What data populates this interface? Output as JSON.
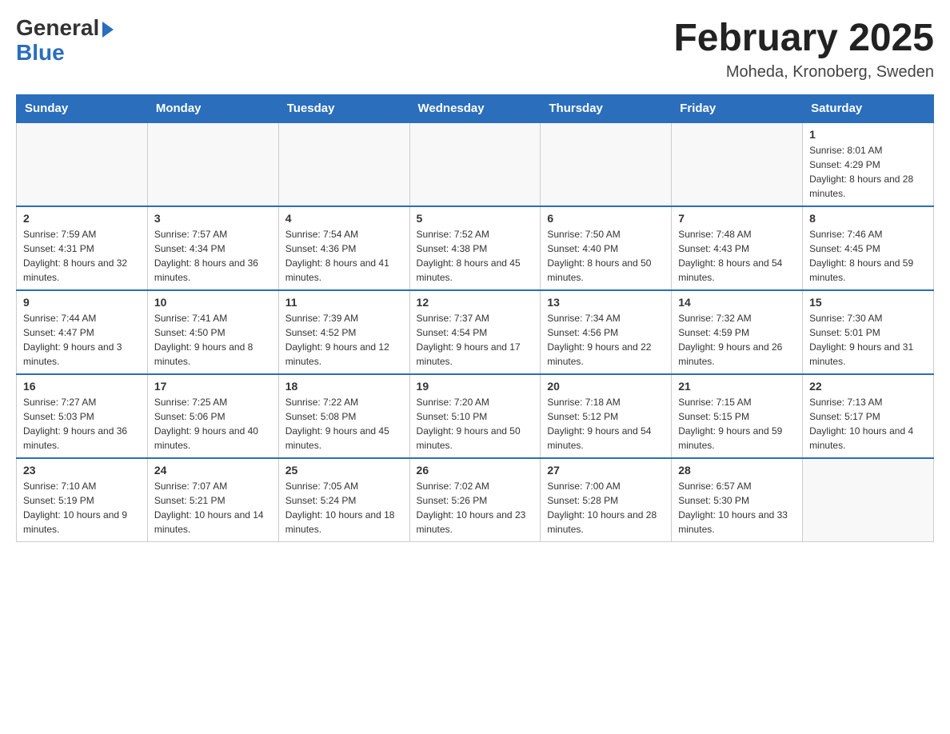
{
  "logo": {
    "general": "General",
    "blue": "Blue",
    "arrow": "▶"
  },
  "title": "February 2025",
  "location": "Moheda, Kronoberg, Sweden",
  "days_of_week": [
    "Sunday",
    "Monday",
    "Tuesday",
    "Wednesday",
    "Thursday",
    "Friday",
    "Saturday"
  ],
  "weeks": [
    {
      "days": [
        {
          "num": "",
          "info": ""
        },
        {
          "num": "",
          "info": ""
        },
        {
          "num": "",
          "info": ""
        },
        {
          "num": "",
          "info": ""
        },
        {
          "num": "",
          "info": ""
        },
        {
          "num": "",
          "info": ""
        },
        {
          "num": "1",
          "info": "Sunrise: 8:01 AM\nSunset: 4:29 PM\nDaylight: 8 hours and 28 minutes."
        }
      ]
    },
    {
      "days": [
        {
          "num": "2",
          "info": "Sunrise: 7:59 AM\nSunset: 4:31 PM\nDaylight: 8 hours and 32 minutes."
        },
        {
          "num": "3",
          "info": "Sunrise: 7:57 AM\nSunset: 4:34 PM\nDaylight: 8 hours and 36 minutes."
        },
        {
          "num": "4",
          "info": "Sunrise: 7:54 AM\nSunset: 4:36 PM\nDaylight: 8 hours and 41 minutes."
        },
        {
          "num": "5",
          "info": "Sunrise: 7:52 AM\nSunset: 4:38 PM\nDaylight: 8 hours and 45 minutes."
        },
        {
          "num": "6",
          "info": "Sunrise: 7:50 AM\nSunset: 4:40 PM\nDaylight: 8 hours and 50 minutes."
        },
        {
          "num": "7",
          "info": "Sunrise: 7:48 AM\nSunset: 4:43 PM\nDaylight: 8 hours and 54 minutes."
        },
        {
          "num": "8",
          "info": "Sunrise: 7:46 AM\nSunset: 4:45 PM\nDaylight: 8 hours and 59 minutes."
        }
      ]
    },
    {
      "days": [
        {
          "num": "9",
          "info": "Sunrise: 7:44 AM\nSunset: 4:47 PM\nDaylight: 9 hours and 3 minutes."
        },
        {
          "num": "10",
          "info": "Sunrise: 7:41 AM\nSunset: 4:50 PM\nDaylight: 9 hours and 8 minutes."
        },
        {
          "num": "11",
          "info": "Sunrise: 7:39 AM\nSunset: 4:52 PM\nDaylight: 9 hours and 12 minutes."
        },
        {
          "num": "12",
          "info": "Sunrise: 7:37 AM\nSunset: 4:54 PM\nDaylight: 9 hours and 17 minutes."
        },
        {
          "num": "13",
          "info": "Sunrise: 7:34 AM\nSunset: 4:56 PM\nDaylight: 9 hours and 22 minutes."
        },
        {
          "num": "14",
          "info": "Sunrise: 7:32 AM\nSunset: 4:59 PM\nDaylight: 9 hours and 26 minutes."
        },
        {
          "num": "15",
          "info": "Sunrise: 7:30 AM\nSunset: 5:01 PM\nDaylight: 9 hours and 31 minutes."
        }
      ]
    },
    {
      "days": [
        {
          "num": "16",
          "info": "Sunrise: 7:27 AM\nSunset: 5:03 PM\nDaylight: 9 hours and 36 minutes."
        },
        {
          "num": "17",
          "info": "Sunrise: 7:25 AM\nSunset: 5:06 PM\nDaylight: 9 hours and 40 minutes."
        },
        {
          "num": "18",
          "info": "Sunrise: 7:22 AM\nSunset: 5:08 PM\nDaylight: 9 hours and 45 minutes."
        },
        {
          "num": "19",
          "info": "Sunrise: 7:20 AM\nSunset: 5:10 PM\nDaylight: 9 hours and 50 minutes."
        },
        {
          "num": "20",
          "info": "Sunrise: 7:18 AM\nSunset: 5:12 PM\nDaylight: 9 hours and 54 minutes."
        },
        {
          "num": "21",
          "info": "Sunrise: 7:15 AM\nSunset: 5:15 PM\nDaylight: 9 hours and 59 minutes."
        },
        {
          "num": "22",
          "info": "Sunrise: 7:13 AM\nSunset: 5:17 PM\nDaylight: 10 hours and 4 minutes."
        }
      ]
    },
    {
      "days": [
        {
          "num": "23",
          "info": "Sunrise: 7:10 AM\nSunset: 5:19 PM\nDaylight: 10 hours and 9 minutes."
        },
        {
          "num": "24",
          "info": "Sunrise: 7:07 AM\nSunset: 5:21 PM\nDaylight: 10 hours and 14 minutes."
        },
        {
          "num": "25",
          "info": "Sunrise: 7:05 AM\nSunset: 5:24 PM\nDaylight: 10 hours and 18 minutes."
        },
        {
          "num": "26",
          "info": "Sunrise: 7:02 AM\nSunset: 5:26 PM\nDaylight: 10 hours and 23 minutes."
        },
        {
          "num": "27",
          "info": "Sunrise: 7:00 AM\nSunset: 5:28 PM\nDaylight: 10 hours and 28 minutes."
        },
        {
          "num": "28",
          "info": "Sunrise: 6:57 AM\nSunset: 5:30 PM\nDaylight: 10 hours and 33 minutes."
        },
        {
          "num": "",
          "info": ""
        }
      ]
    }
  ]
}
